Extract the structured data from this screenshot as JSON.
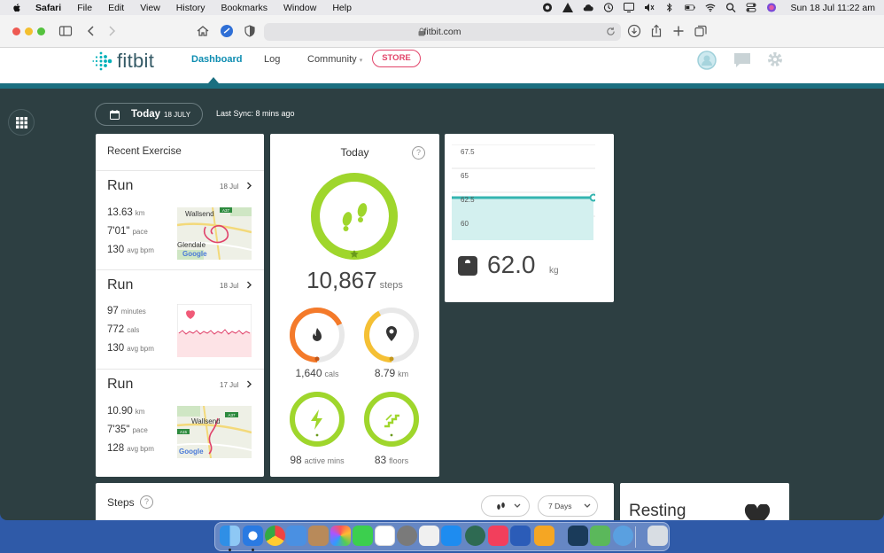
{
  "menubar": {
    "app": "Safari",
    "items": [
      "File",
      "Edit",
      "View",
      "History",
      "Bookmarks",
      "Window",
      "Help"
    ],
    "clock": "Sun 18 Jul  11:22 am"
  },
  "browser": {
    "url": "fitbit.com"
  },
  "fitbit": {
    "logo": "fitbit",
    "nav": {
      "dashboard": "Dashboard",
      "log": "Log",
      "community": "Community",
      "store": "STORE"
    },
    "date": {
      "today": "Today",
      "date": "18 JULY",
      "sync": "Last Sync: 8 mins ago"
    },
    "exercise": {
      "title": "Recent Exercise",
      "runs": [
        {
          "name": "Run",
          "date": "18 Jul",
          "stats": [
            {
              "value": "13.63",
              "unit": "km"
            },
            {
              "value": "7'01\"",
              "unit": "pace"
            },
            {
              "value": "130",
              "unit": "avg bpm"
            }
          ],
          "map_labels": [
            "Wallsend",
            "Glendale",
            "A37"
          ],
          "map_brand": "Google"
        },
        {
          "name": "Run",
          "date": "18 Jul",
          "stats": [
            {
              "value": "97",
              "unit": "minutes"
            },
            {
              "value": "772",
              "unit": "cals"
            },
            {
              "value": "130",
              "unit": "avg bpm"
            }
          ]
        },
        {
          "name": "Run",
          "date": "17 Jul",
          "stats": [
            {
              "value": "10.90",
              "unit": "km"
            },
            {
              "value": "7'35\"",
              "unit": "pace"
            },
            {
              "value": "128",
              "unit": "avg bpm"
            }
          ],
          "map_labels": [
            "Wallsend",
            "A37",
            "A15"
          ],
          "map_brand": "Google"
        }
      ]
    },
    "today": {
      "title": "Today",
      "help": "?",
      "steps": {
        "value": "10,867",
        "unit": "steps",
        "progress": 1.0
      },
      "rings": [
        {
          "value": "1,640",
          "unit": "cals",
          "color": "#f47a2a",
          "progress": 0.68
        },
        {
          "value": "8.79",
          "unit": "km",
          "color": "#f5c034",
          "progress": 0.42
        },
        {
          "value": "98",
          "unit": "active mins",
          "color": "#9fd62c",
          "progress": 1.0
        },
        {
          "value": "83",
          "unit": "floors",
          "color": "#9fd62c",
          "progress": 1.0
        }
      ]
    },
    "weight": {
      "ticks": [
        "67.5",
        "65",
        "62.5",
        "60"
      ],
      "value": "62.0",
      "unit": "kg"
    },
    "steps_card": {
      "title": "Steps",
      "help": "?",
      "range": "7 Days"
    },
    "resting": {
      "title": "Resting"
    },
    "colors": {
      "teal": "#1b6f80",
      "green": "#9fd62c",
      "store": "#e2446a"
    }
  }
}
